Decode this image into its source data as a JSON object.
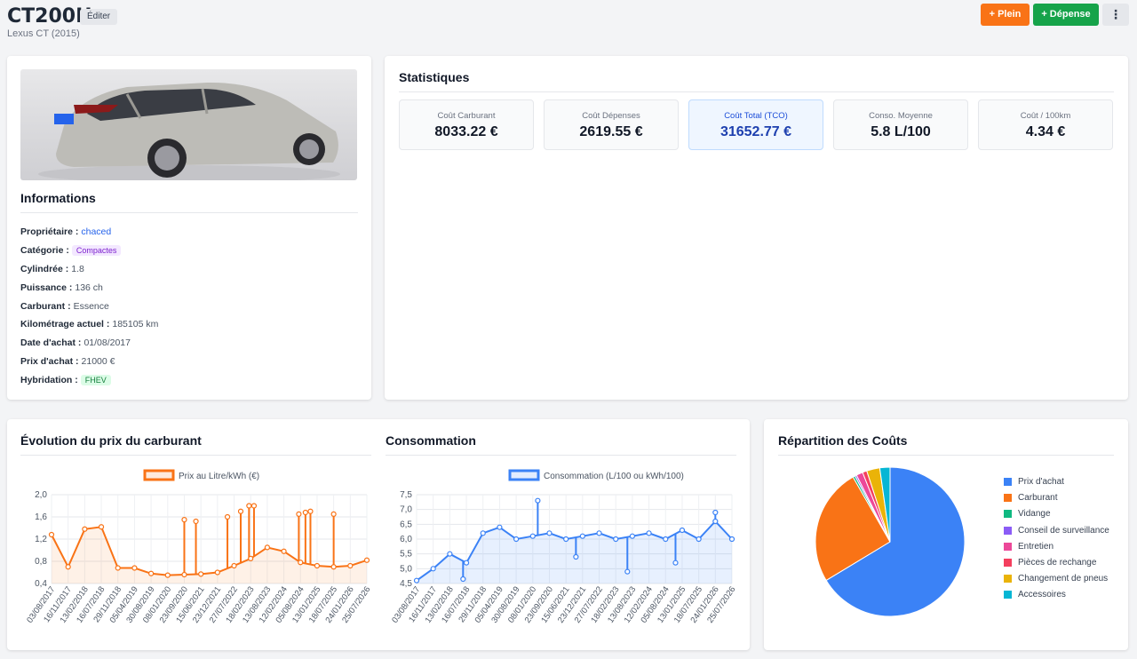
{
  "header": {
    "title": "CT200H",
    "edit_label": "Éditer",
    "subtitle": "Lexus CT (2015)",
    "add_fuel_label": "+ Plein",
    "add_expense_label": "+ Dépense",
    "more_icon": "⋮"
  },
  "info": {
    "heading": "Informations",
    "owner_label": "Propriétaire :",
    "owner": "chaced",
    "category_label": "Catégorie :",
    "category": "Compactes",
    "displacement_label": "Cylindrée :",
    "displacement": "1.8",
    "power_label": "Puissance :",
    "power": "136 ch",
    "fuel_label": "Carburant :",
    "fuel": "Essence",
    "mileage_label": "Kilométrage actuel :",
    "mileage": "185105 km",
    "purchase_date_label": "Date d'achat :",
    "purchase_date": "01/08/2017",
    "purchase_price_label": "Prix d'achat :",
    "purchase_price": "21000 €",
    "hybrid_label": "Hybridation :",
    "hybrid": "FHEV"
  },
  "stats": {
    "heading": "Statistiques",
    "items": [
      {
        "label": "Coût Carburant",
        "value": "8033.22 €"
      },
      {
        "label": "Coût Dépenses",
        "value": "2619.55 €"
      },
      {
        "label": "Coût Total (TCO)",
        "value": "31652.77 €"
      },
      {
        "label": "Conso. Moyenne",
        "value": "5.8 L/100"
      },
      {
        "label": "Coût / 100km",
        "value": "4.34 €"
      }
    ]
  },
  "charts": {
    "price_heading": "Évolution du prix du carburant",
    "consumption_heading": "Consommation",
    "costs_heading": "Répartition des Coûts"
  },
  "chart_data": [
    {
      "type": "line",
      "legend": "Prix au Litre/kWh (€)",
      "color": "#f97316",
      "ylim": [
        0.4,
        2.0
      ],
      "yticks": [
        "2,0",
        "1,6",
        "1,2",
        "0,8",
        "0,4"
      ],
      "x": [
        "03/08/2017",
        "16/11/2017",
        "13/02/2018",
        "16/07/2018",
        "29/11/2018",
        "05/04/2019",
        "30/08/2019",
        "08/01/2020",
        "23/09/2020",
        "15/06/2021",
        "23/12/2021",
        "27/07/2022",
        "18/02/2023",
        "13/08/2023",
        "12/02/2024",
        "05/08/2024",
        "13/01/2025",
        "18/07/2025",
        "24/01/2026",
        "25/07/2026"
      ],
      "values": [
        1.28,
        0.7,
        1.38,
        1.42,
        0.68,
        0.68,
        0.58,
        0.55,
        0.56,
        0.57,
        0.6,
        0.72,
        0.85,
        1.05,
        0.98,
        0.78,
        0.72,
        0.7,
        0.72,
        0.82
      ],
      "spikes": [
        {
          "x": 8.0,
          "value": 1.55
        },
        {
          "x": 8.7,
          "value": 1.52
        },
        {
          "x": 10.6,
          "value": 1.6
        },
        {
          "x": 11.4,
          "value": 1.7
        },
        {
          "x": 11.9,
          "value": 1.8
        },
        {
          "x": 12.2,
          "value": 1.8
        },
        {
          "x": 14.9,
          "value": 1.65
        },
        {
          "x": 15.3,
          "value": 1.68
        },
        {
          "x": 15.6,
          "value": 1.7
        },
        {
          "x": 17.0,
          "value": 1.65
        }
      ]
    },
    {
      "type": "area",
      "legend": "Consommation (L/100 ou kWh/100)",
      "color": "#3b82f6",
      "ylim": [
        4.5,
        7.5
      ],
      "yticks": [
        "7,5",
        "7,0",
        "6,5",
        "6,0",
        "5,5",
        "5,0",
        "4,5"
      ],
      "x": [
        "03/08/2017",
        "16/11/2017",
        "13/02/2018",
        "16/07/2018",
        "29/11/2018",
        "05/04/2019",
        "30/08/2019",
        "08/01/2020",
        "23/09/2020",
        "15/06/2021",
        "23/12/2021",
        "27/07/2022",
        "18/02/2023",
        "13/08/2023",
        "12/02/2024",
        "05/08/2024",
        "13/01/2025",
        "18/07/2025",
        "24/01/2026",
        "25/07/2026"
      ],
      "values": [
        4.6,
        5.0,
        5.5,
        5.2,
        6.2,
        6.4,
        6.0,
        6.1,
        6.2,
        6.0,
        6.1,
        6.2,
        6.0,
        6.1,
        6.2,
        6.0,
        6.3,
        6.0,
        6.6,
        6.0
      ],
      "spikes": [
        {
          "x": 2.8,
          "value": 4.65
        },
        {
          "x": 7.3,
          "value": 7.3
        },
        {
          "x": 9.6,
          "value": 5.4
        },
        {
          "x": 12.7,
          "value": 4.9
        },
        {
          "x": 15.6,
          "value": 5.2
        },
        {
          "x": 18.0,
          "value": 6.9
        }
      ]
    },
    {
      "type": "pie",
      "legend": [
        {
          "name": "Prix d'achat",
          "value": 21000,
          "color": "#3b82f6"
        },
        {
          "name": "Carburant",
          "value": 8033.22,
          "color": "#f97316"
        },
        {
          "name": "Vidange",
          "value": 150,
          "color": "#10b981"
        },
        {
          "name": "Conseil de surveillance",
          "value": 120,
          "color": "#8b5cf6"
        },
        {
          "name": "Entretien",
          "value": 450,
          "color": "#ec4899"
        },
        {
          "name": "Pièces de rechange",
          "value": 300,
          "color": "#f43f5e"
        },
        {
          "name": "Changement de pneus",
          "value": 900,
          "color": "#eab308"
        },
        {
          "name": "Accessoires",
          "value": 700,
          "color": "#06b6d4"
        }
      ]
    }
  ]
}
